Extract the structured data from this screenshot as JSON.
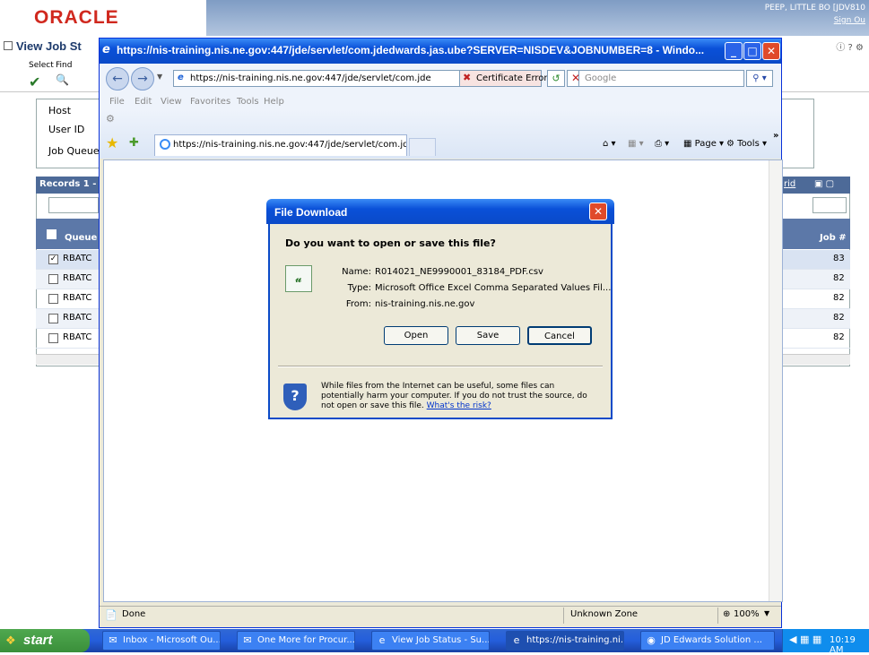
{
  "oracle": {
    "logo": "ORACLE",
    "user": "PEEP, LITTLE BO  [JDV810",
    "signout": "Sign Ou",
    "page_title": "View Job St",
    "toolbar": {
      "select": "Select",
      "find": "Find"
    },
    "form_labels": {
      "host": "Host",
      "user_id": "User ID",
      "job_queue": "Job Queue"
    },
    "grid": {
      "header": "Records 1 -",
      "grid_link": "rid",
      "col_queue": "Queue",
      "col_job": "Job #",
      "rows": [
        {
          "queue": "RBATC",
          "job": "83",
          "checked": true
        },
        {
          "queue": "RBATC",
          "job": "82",
          "checked": false
        },
        {
          "queue": "RBATC",
          "job": "82",
          "checked": false
        },
        {
          "queue": "RBATC",
          "job": "82",
          "checked": false
        },
        {
          "queue": "RBATC",
          "job": "82",
          "checked": false
        }
      ]
    }
  },
  "ie": {
    "title": "https://nis-training.nis.ne.gov:447/jde/servlet/com.jdedwards.jas.ube?SERVER=NISDEV&JOBNUMBER=8 - Windo...",
    "url": "https://nis-training.nis.ne.gov:447/jde/servlet/com.jde",
    "cert_error": "Certificate Error",
    "search_placeholder": "Google",
    "menu": [
      "File",
      "Edit",
      "View",
      "Favorites",
      "Tools",
      "Help"
    ],
    "tab_label": "https://nis-training.nis.ne.gov:447/jde/servlet/com.jd...",
    "cmd_page": "Page",
    "cmd_tools": "Tools",
    "status": {
      "done": "Done",
      "zone": "Unknown Zone",
      "zoom": "100%"
    }
  },
  "dialog": {
    "title": "File Download",
    "question": "Do you want to open or save this file?",
    "name_label": "Name:",
    "name_value": "R014021_NE9990001_83184_PDF.csv",
    "type_label": "Type:",
    "type_value": "Microsoft Office Excel Comma Separated Values Fil...",
    "from_label": "From:",
    "from_value": "nis-training.nis.ne.gov",
    "btn_open": "Open",
    "btn_save": "Save",
    "btn_cancel": "Cancel",
    "warning": "While files from the Internet can be useful, some files can potentially harm your computer. If you do not trust the source, do not open or save this file.",
    "risk_link": "What's the risk?"
  },
  "taskbar": {
    "start": "start",
    "items": [
      {
        "label": "Inbox - Microsoft Ou...",
        "icon": "outlook-icon"
      },
      {
        "label": "One More for Procur...",
        "icon": "mail-icon"
      },
      {
        "label": "View Job Status - Su...",
        "icon": "ie-icon"
      },
      {
        "label": "https://nis-training.ni...",
        "icon": "ie-icon"
      },
      {
        "label": "JD Edwards Solution ...",
        "icon": "lightbulb-icon"
      }
    ],
    "clock": "10:19 AM"
  },
  "colors": {
    "oracle_red": "#d0281e",
    "xp_blue": "#0a50d8",
    "grid_header": "#4d6a98"
  }
}
